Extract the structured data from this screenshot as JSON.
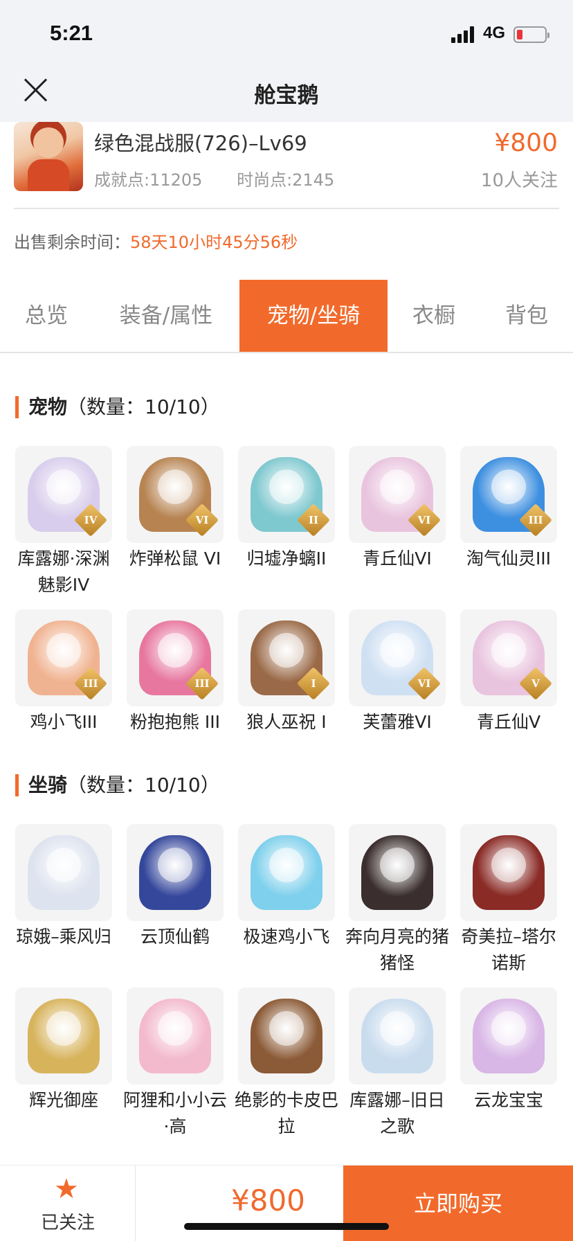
{
  "status": {
    "time": "5:21",
    "network": "4G"
  },
  "nav": {
    "title": "舱宝鹅"
  },
  "product": {
    "name": "绿色混战服(726)–Lv69",
    "achievement": "成就点:11205",
    "fashion": "时尚点:2145",
    "price": "¥800",
    "followers": "10人关注"
  },
  "sale": {
    "label": "出售剩余时间：",
    "remaining": "58天10小时45分56秒"
  },
  "tabs": [
    "总览",
    "装备/属性",
    "宠物/坐骑",
    "衣橱",
    "背包"
  ],
  "active_tab": "宠物/坐骑",
  "pets": {
    "title": "宠物",
    "count": "（数量：10/10）",
    "items": [
      {
        "name": "库露娜·深渊魅影IV",
        "rank": "IV",
        "color": "#d8cdec"
      },
      {
        "name": "炸弹松鼠 VI",
        "rank": "VI",
        "color": "#b78351"
      },
      {
        "name": "归墟净螭II",
        "rank": "II",
        "color": "#7ec8cf"
      },
      {
        "name": "青丘仙VI",
        "rank": "VI",
        "color": "#e9c4de"
      },
      {
        "name": "淘气仙灵III",
        "rank": "III",
        "color": "#3d8fe0"
      },
      {
        "name": "鸡小飞III",
        "rank": "III",
        "color": "#f0b391"
      },
      {
        "name": "粉抱抱熊 III",
        "rank": "III",
        "color": "#e7779f"
      },
      {
        "name": "狼人巫祝 I",
        "rank": "I",
        "color": "#9a6a48"
      },
      {
        "name": "芙蕾雅VI",
        "rank": "VI",
        "color": "#cfe0f3"
      },
      {
        "name": "青丘仙V",
        "rank": "V",
        "color": "#e9c4de"
      }
    ]
  },
  "mounts": {
    "title": "坐骑",
    "count": "（数量：10/10）",
    "items": [
      {
        "name": "琼娥–乘风归",
        "color": "#dde3ef"
      },
      {
        "name": "云顶仙鹤",
        "color": "#35479b"
      },
      {
        "name": "极速鸡小飞",
        "color": "#7fd0ec"
      },
      {
        "name": "奔向月亮的猪猪怪",
        "color": "#3b2e2e"
      },
      {
        "name": "奇美拉–塔尔诺斯",
        "color": "#8a2b26"
      },
      {
        "name": "辉光御座",
        "color": "#d7b35c"
      },
      {
        "name": "阿狸和小小云·高",
        "color": "#f3b9cd"
      },
      {
        "name": "绝影的卡皮巴拉",
        "color": "#8b5a36"
      },
      {
        "name": "库露娜–旧日之歌",
        "color": "#c9dcee"
      },
      {
        "name": "云龙宝宝",
        "color": "#d8b6e6"
      }
    ]
  },
  "bottom": {
    "follow_label": "已关注",
    "price": "¥800",
    "buy_label": "立即购买"
  },
  "colors": {
    "accent": "#f26a2b",
    "price": "#f06a2e"
  }
}
